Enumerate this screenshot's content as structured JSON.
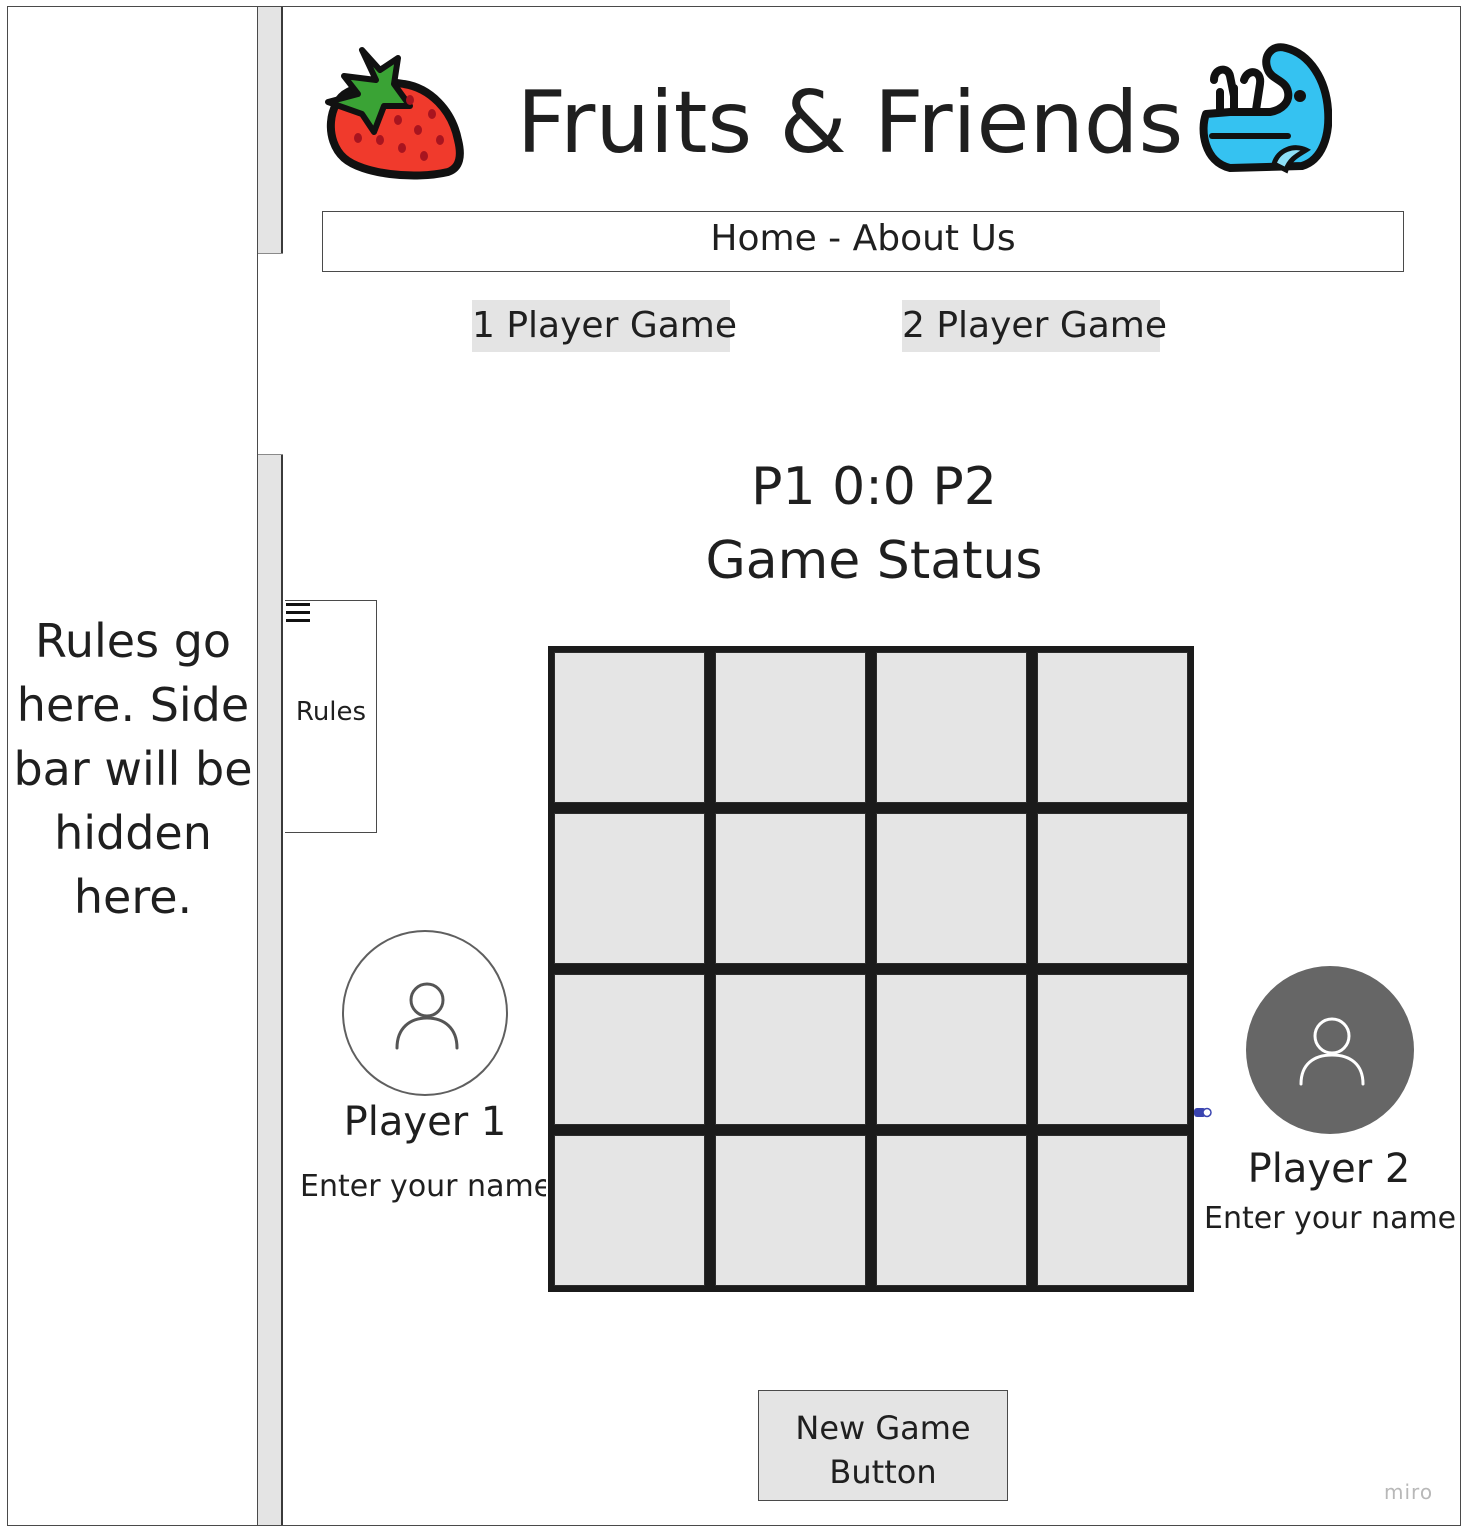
{
  "app": {
    "title": "Fruits & Friends",
    "logo_left_icon": "strawberry-icon",
    "logo_right_icon": "whale-icon"
  },
  "nav": {
    "label": "Home - About Us"
  },
  "modes": {
    "one_player": "1 Player Game",
    "two_player": "2 Player Game"
  },
  "score": {
    "text": "P1 0:0 P2"
  },
  "game_status": "Game Status",
  "sidebar": {
    "text": "Rules go here. Side bar will be hidden here.",
    "tab_label": "Rules",
    "tab_icon": "hamburger-menu-icon"
  },
  "board": {
    "rows": 4,
    "cols": 4,
    "cells": [
      "",
      "",
      "",
      "",
      "",
      "",
      "",
      "",
      "",
      "",
      "",
      "",
      "",
      "",
      "",
      ""
    ]
  },
  "players": [
    {
      "label": "Player 1",
      "name_placeholder": "Enter your name",
      "name_value": "",
      "avatar_icon": "user-icon"
    },
    {
      "label": "Player 2",
      "name_placeholder": "Enter your name",
      "name_value": "",
      "avatar_icon": "user-icon"
    }
  ],
  "new_game": {
    "label": "New Game\nButton"
  },
  "watermark": "miro",
  "colors": {
    "cell_fill": "#e5e5e5",
    "grid_lines": "#1b1b1b",
    "button_fill": "#e4e4e4",
    "player2_avatar": "#666666",
    "strawberry": "#f03a2c",
    "whale": "#35c2f1"
  }
}
